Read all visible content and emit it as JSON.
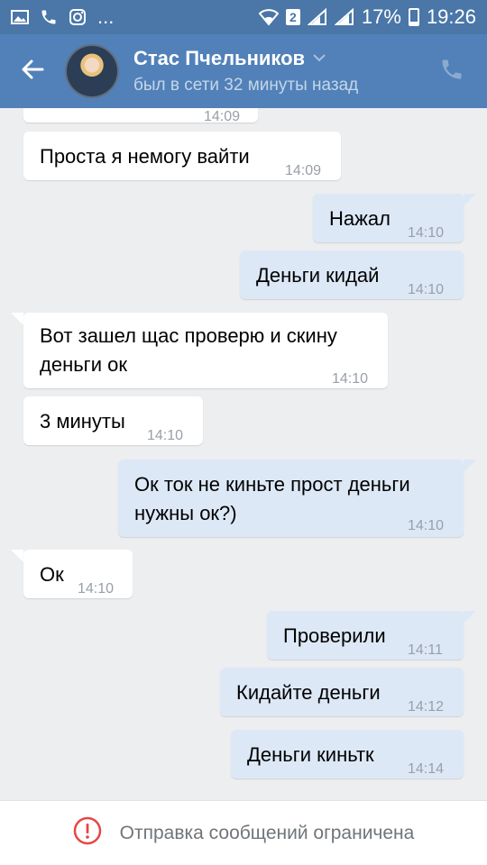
{
  "status_bar": {
    "battery": "17%",
    "time": "19:26",
    "ellipsis": "...",
    "sim": "2"
  },
  "header": {
    "name": "Стас Пчельников",
    "status": "был в сети 32 минуты назад"
  },
  "messages": [
    {
      "dir": "in",
      "text": "",
      "time": "14:09"
    },
    {
      "dir": "in",
      "text": "Проста я немогу вайти",
      "time": "14:09"
    },
    {
      "dir": "out",
      "text": "Нажал",
      "time": "14:10"
    },
    {
      "dir": "out",
      "text": "Деньги кидай",
      "time": "14:10"
    },
    {
      "dir": "in",
      "text": "Вот зашел щас проверю и скину",
      "text2": "деньги ок",
      "time": "14:10"
    },
    {
      "dir": "in",
      "text": "3 минуты",
      "time": "14:10"
    },
    {
      "dir": "out",
      "text": "Ок ток не киньте прост деньги",
      "text2": "нужны ок?)",
      "time": "14:10"
    },
    {
      "dir": "in",
      "text": "Ок",
      "time": "14:10"
    },
    {
      "dir": "out",
      "text": "Проверили",
      "time": "14:11"
    },
    {
      "dir": "out",
      "text": "Кидайте деньги",
      "time": "14:12"
    },
    {
      "dir": "out",
      "text": "Деньги киньтк",
      "time": "14:14"
    }
  ],
  "footer": {
    "notice": "Отправка сообщений ограничена"
  },
  "colors": {
    "header_bg": "#5181b8",
    "status_bg": "#4a76a8",
    "chat_bg": "#edeef0",
    "outgoing_bubble": "#dde8f6",
    "incoming_bubble": "#ffffff",
    "error_icon": "#e64646"
  },
  "icons": [
    "image-icon",
    "phone-icon",
    "instagram-icon",
    "wifi-icon",
    "signal-icon",
    "battery-icon",
    "back-arrow-icon",
    "chevron-down-icon",
    "call-icon",
    "error-icon"
  ]
}
